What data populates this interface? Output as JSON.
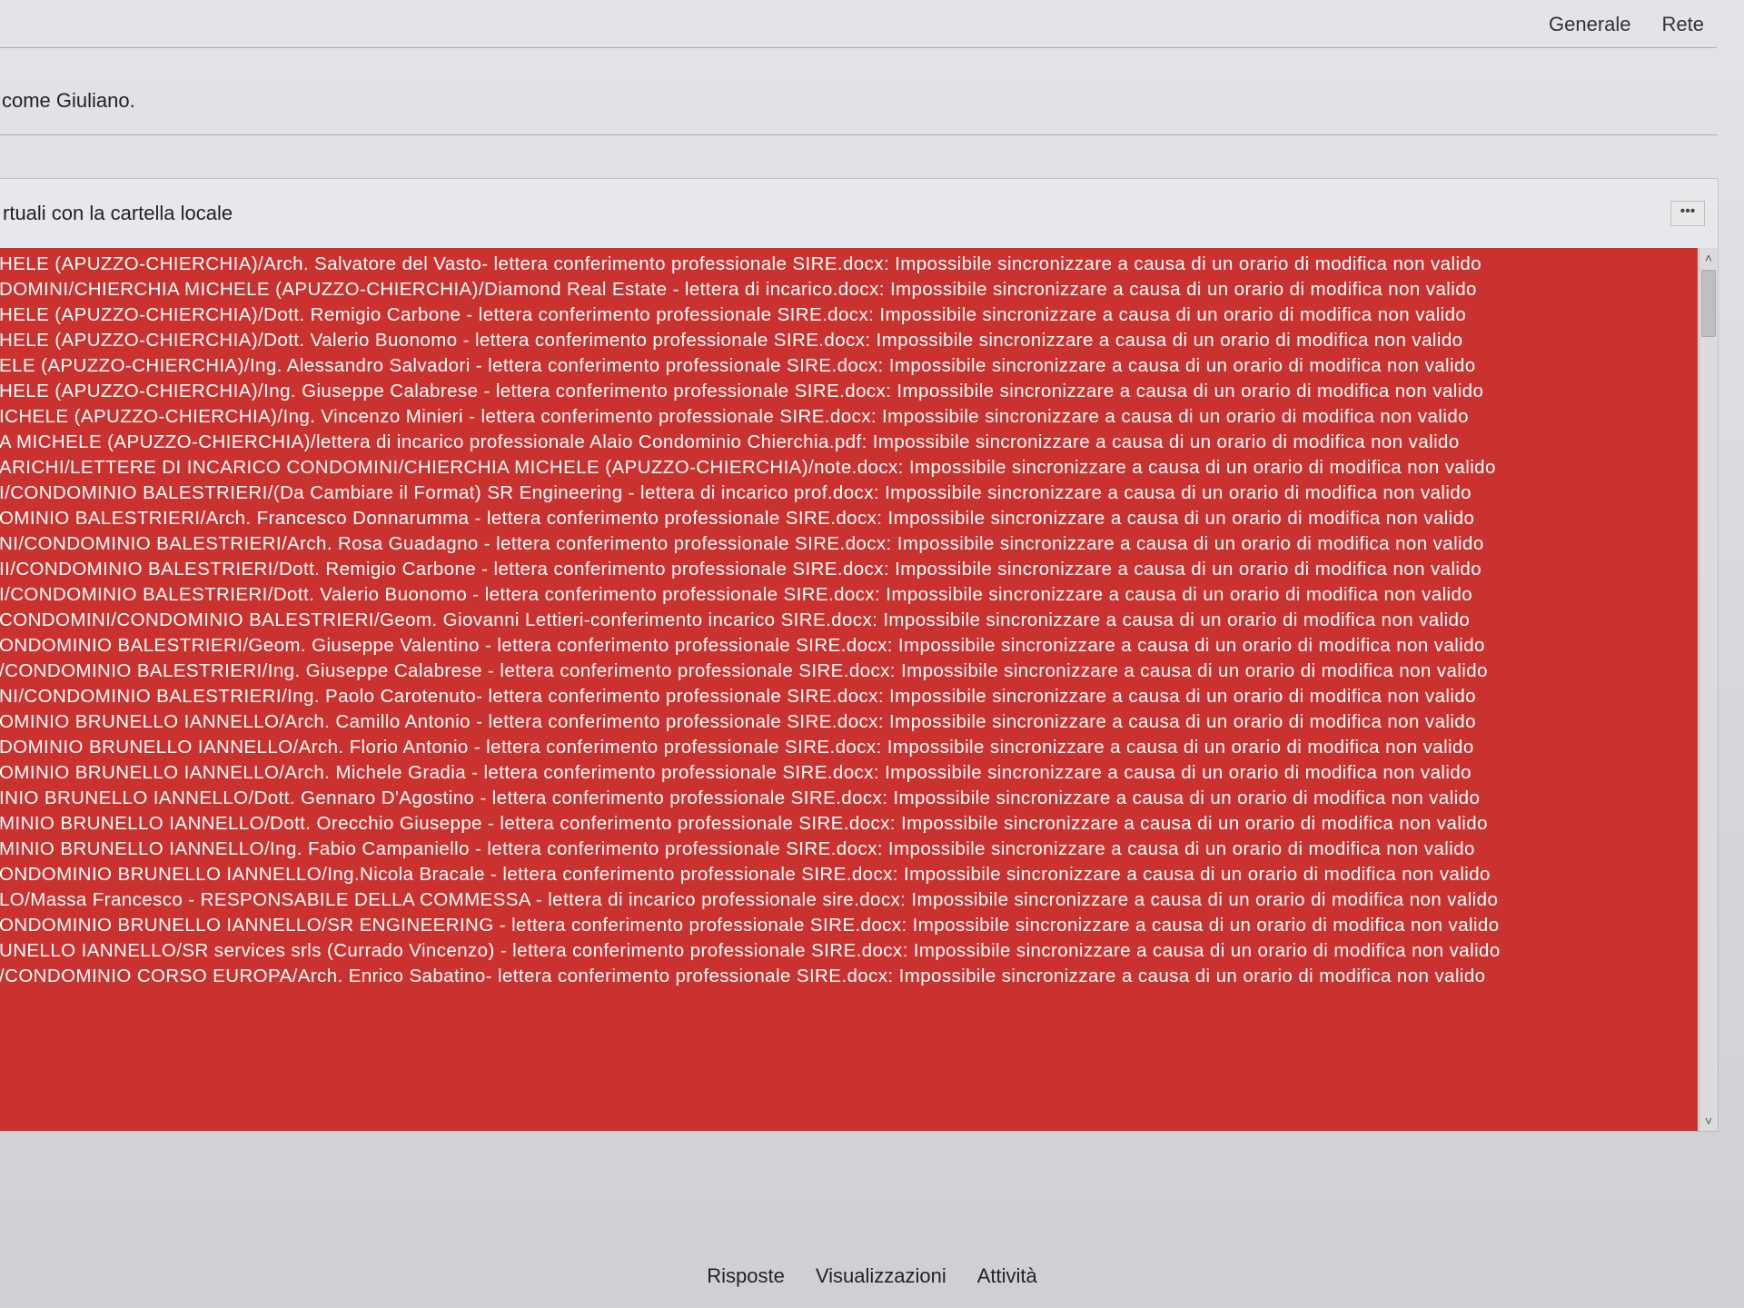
{
  "tabs": {
    "general": "Generale",
    "network": "Rete"
  },
  "welcome": "come Giuliano.",
  "panel": {
    "title": "rtuali con la cartella locale",
    "more_label": "•••"
  },
  "error_suffix": "Impossibile sincronizzare a causa di un orario di modifica non valido",
  "rows": [
    "HELE (APUZZO-CHIERCHIA)/Arch. Salvatore del Vasto- lettera conferimento professionale SIRE.docx:",
    "DOMINI/CHIERCHIA MICHELE (APUZZO-CHIERCHIA)/Diamond Real Estate - lettera di incarico.docx:",
    "HELE (APUZZO-CHIERCHIA)/Dott. Remigio Carbone - lettera conferimento professionale SIRE.docx:",
    "HELE (APUZZO-CHIERCHIA)/Dott. Valerio Buonomo - lettera conferimento professionale SIRE.docx:",
    "ELE (APUZZO-CHIERCHIA)/Ing. Alessandro Salvadori - lettera conferimento professionale SIRE.docx:",
    "HELE (APUZZO-CHIERCHIA)/Ing. Giuseppe Calabrese - lettera conferimento professionale SIRE.docx:",
    "ICHELE (APUZZO-CHIERCHIA)/Ing. Vincenzo Minieri - lettera conferimento professionale SIRE.docx:",
    "A MICHELE (APUZZO-CHIERCHIA)/lettera di incarico professionale Alaio Condominio Chierchia.pdf:",
    "ARICHI/LETTERE DI INCARICO CONDOMINI/CHIERCHIA MICHELE (APUZZO-CHIERCHIA)/note.docx:",
    "I/CONDOMINIO BALESTRIERI/(Da Cambiare il Format) SR Engineering - lettera di incarico prof.docx:",
    "OMINIO BALESTRIERI/Arch. Francesco Donnarumma - lettera conferimento professionale SIRE.docx:",
    "NI/CONDOMINIO BALESTRIERI/Arch. Rosa Guadagno - lettera conferimento professionale SIRE.docx:",
    "II/CONDOMINIO BALESTRIERI/Dott. Remigio Carbone - lettera conferimento professionale SIRE.docx:",
    "I/CONDOMINIO BALESTRIERI/Dott. Valerio Buonomo - lettera conferimento professionale SIRE.docx:",
    "CONDOMINI/CONDOMINIO BALESTRIERI/Geom. Giovanni Lettieri-conferimento incarico SIRE.docx:",
    "ONDOMINIO BALESTRIERI/Geom. Giuseppe Valentino - lettera conferimento professionale SIRE.docx:",
    "/CONDOMINIO BALESTRIERI/Ing. Giuseppe Calabrese - lettera conferimento professionale SIRE.docx:",
    "NI/CONDOMINIO BALESTRIERI/Ing. Paolo Carotenuto- lettera conferimento professionale SIRE.docx:",
    "OMINIO BRUNELLO IANNELLO/Arch. Camillo Antonio - lettera conferimento professionale SIRE.docx:",
    "DOMINIO BRUNELLO IANNELLO/Arch. Florio Antonio - lettera conferimento professionale SIRE.docx:",
    "OMINIO BRUNELLO IANNELLO/Arch. Michele Gradia - lettera conferimento professionale SIRE.docx:",
    "INIO BRUNELLO IANNELLO/Dott. Gennaro D'Agostino - lettera conferimento professionale SIRE.docx:",
    "MINIO BRUNELLO IANNELLO/Dott. Orecchio Giuseppe - lettera conferimento professionale SIRE.docx:",
    "MINIO BRUNELLO IANNELLO/Ing. Fabio Campaniello - lettera conferimento professionale SIRE.docx:",
    "ONDOMINIO BRUNELLO IANNELLO/Ing.Nicola Bracale - lettera conferimento professionale SIRE.docx:",
    "LO/Massa Francesco - RESPONSABILE DELLA COMMESSA - lettera di incarico professionale sire.docx:",
    "ONDOMINIO BRUNELLO IANNELLO/SR ENGINEERING - lettera conferimento professionale SIRE.docx:",
    "UNELLO IANNELLO/SR services srls (Currado Vincenzo) - lettera conferimento professionale SIRE.docx:",
    "/CONDOMINIO CORSO EUROPA/Arch. Enrico Sabatino- lettera conferimento professionale SIRE.docx:"
  ],
  "footer": {
    "replies": "Risposte",
    "views": "Visualizzazioni",
    "activity": "Attività"
  },
  "scroll": {
    "up": "˄",
    "down": "˅"
  }
}
